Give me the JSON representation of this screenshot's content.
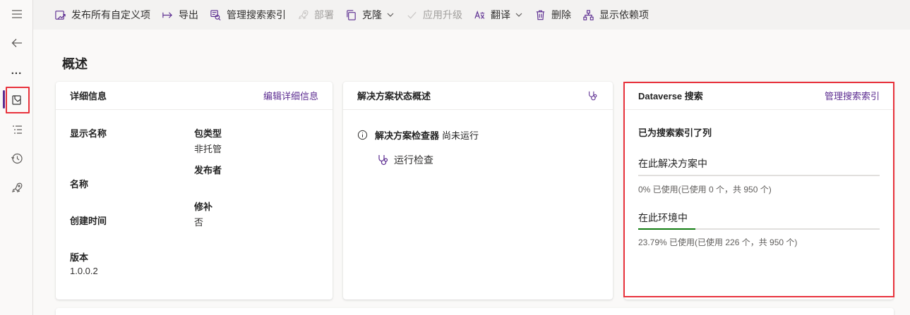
{
  "commandbar": {
    "items": [
      {
        "label": "发布所有自定义项",
        "icon": "publish-icon",
        "disabled": false
      },
      {
        "label": "导出",
        "icon": "export-icon",
        "disabled": false
      },
      {
        "label": "管理搜索索引",
        "icon": "search-index-icon",
        "disabled": false
      },
      {
        "label": "部署",
        "icon": "rocket-icon",
        "disabled": true
      },
      {
        "label": "克隆",
        "icon": "clone-icon",
        "disabled": false,
        "dropdown": true
      },
      {
        "label": "应用升级",
        "icon": "checkmark-icon",
        "disabled": true
      },
      {
        "label": "翻译",
        "icon": "translate-icon",
        "disabled": false,
        "dropdown": true
      },
      {
        "label": "删除",
        "icon": "delete-icon",
        "disabled": false
      },
      {
        "label": "显示依赖项",
        "icon": "dependencies-icon",
        "disabled": false
      }
    ]
  },
  "rail": {
    "items": [
      "hamburger-icon",
      "back-arrow-icon",
      "more-icon",
      "overview-icon",
      "objects-icon",
      "history-icon",
      "pipelines-rocket-icon"
    ],
    "ellipsis": "..."
  },
  "page": {
    "title": "概述"
  },
  "details_card": {
    "title": "详细信息",
    "edit_link": "编辑详细信息",
    "display_name_label": "显示名称",
    "name_label": "名称",
    "created_label": "创建时间",
    "version_label": "版本",
    "version_value": "1.0.0.2",
    "package_type_label": "包类型",
    "package_type_value": "非托管",
    "publisher_label": "发布者",
    "patch_label": "修补",
    "patch_value": "否"
  },
  "health_card": {
    "title": "解决方案状态概述",
    "checker_label": "解决方案检查器",
    "checker_status": "尚未运行",
    "run_check": "运行检查"
  },
  "search_card": {
    "title": "Dataverse 搜索",
    "manage_link": "管理搜索索引",
    "subtitle": "已为搜索索引了列",
    "solution_label": "在此解决方案中",
    "solution_usage_fraction": 0.0,
    "solution_usage_text": "0% 已使用(已使用 0 个，共 950 个)",
    "env_label": "在此环境中",
    "env_usage_fraction": 0.2379,
    "env_usage_text": "23.79% 已使用(已使用 226 个，共 950 个)"
  },
  "colors": {
    "accent": "#5c2d91",
    "progress": "#107c10",
    "highlight": "#e8323c"
  }
}
